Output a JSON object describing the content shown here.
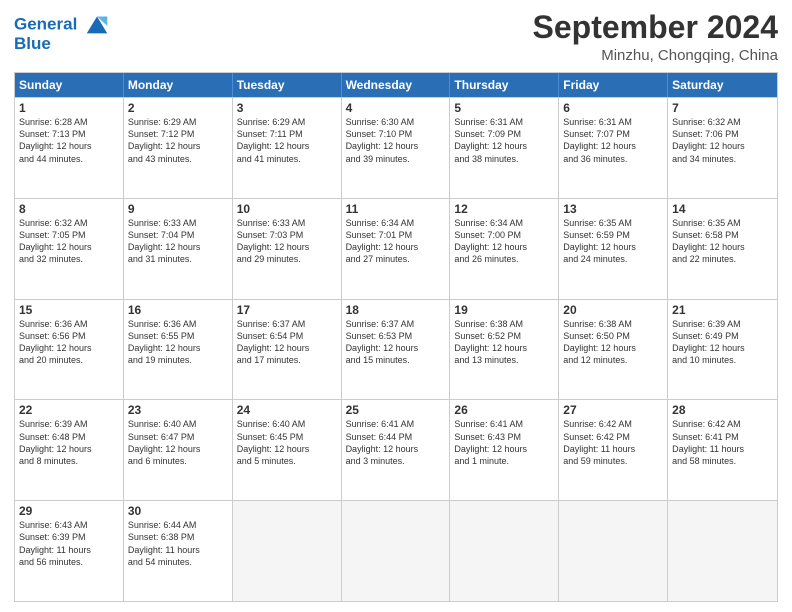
{
  "header": {
    "logo_line1": "General",
    "logo_line2": "Blue",
    "month": "September 2024",
    "location": "Minzhu, Chongqing, China"
  },
  "weekdays": [
    "Sunday",
    "Monday",
    "Tuesday",
    "Wednesday",
    "Thursday",
    "Friday",
    "Saturday"
  ],
  "rows": [
    [
      {
        "day": "1",
        "lines": [
          "Sunrise: 6:28 AM",
          "Sunset: 7:13 PM",
          "Daylight: 12 hours",
          "and 44 minutes."
        ]
      },
      {
        "day": "2",
        "lines": [
          "Sunrise: 6:29 AM",
          "Sunset: 7:12 PM",
          "Daylight: 12 hours",
          "and 43 minutes."
        ]
      },
      {
        "day": "3",
        "lines": [
          "Sunrise: 6:29 AM",
          "Sunset: 7:11 PM",
          "Daylight: 12 hours",
          "and 41 minutes."
        ]
      },
      {
        "day": "4",
        "lines": [
          "Sunrise: 6:30 AM",
          "Sunset: 7:10 PM",
          "Daylight: 12 hours",
          "and 39 minutes."
        ]
      },
      {
        "day": "5",
        "lines": [
          "Sunrise: 6:31 AM",
          "Sunset: 7:09 PM",
          "Daylight: 12 hours",
          "and 38 minutes."
        ]
      },
      {
        "day": "6",
        "lines": [
          "Sunrise: 6:31 AM",
          "Sunset: 7:07 PM",
          "Daylight: 12 hours",
          "and 36 minutes."
        ]
      },
      {
        "day": "7",
        "lines": [
          "Sunrise: 6:32 AM",
          "Sunset: 7:06 PM",
          "Daylight: 12 hours",
          "and 34 minutes."
        ]
      }
    ],
    [
      {
        "day": "8",
        "lines": [
          "Sunrise: 6:32 AM",
          "Sunset: 7:05 PM",
          "Daylight: 12 hours",
          "and 32 minutes."
        ]
      },
      {
        "day": "9",
        "lines": [
          "Sunrise: 6:33 AM",
          "Sunset: 7:04 PM",
          "Daylight: 12 hours",
          "and 31 minutes."
        ]
      },
      {
        "day": "10",
        "lines": [
          "Sunrise: 6:33 AM",
          "Sunset: 7:03 PM",
          "Daylight: 12 hours",
          "and 29 minutes."
        ]
      },
      {
        "day": "11",
        "lines": [
          "Sunrise: 6:34 AM",
          "Sunset: 7:01 PM",
          "Daylight: 12 hours",
          "and 27 minutes."
        ]
      },
      {
        "day": "12",
        "lines": [
          "Sunrise: 6:34 AM",
          "Sunset: 7:00 PM",
          "Daylight: 12 hours",
          "and 26 minutes."
        ]
      },
      {
        "day": "13",
        "lines": [
          "Sunrise: 6:35 AM",
          "Sunset: 6:59 PM",
          "Daylight: 12 hours",
          "and 24 minutes."
        ]
      },
      {
        "day": "14",
        "lines": [
          "Sunrise: 6:35 AM",
          "Sunset: 6:58 PM",
          "Daylight: 12 hours",
          "and 22 minutes."
        ]
      }
    ],
    [
      {
        "day": "15",
        "lines": [
          "Sunrise: 6:36 AM",
          "Sunset: 6:56 PM",
          "Daylight: 12 hours",
          "and 20 minutes."
        ]
      },
      {
        "day": "16",
        "lines": [
          "Sunrise: 6:36 AM",
          "Sunset: 6:55 PM",
          "Daylight: 12 hours",
          "and 19 minutes."
        ]
      },
      {
        "day": "17",
        "lines": [
          "Sunrise: 6:37 AM",
          "Sunset: 6:54 PM",
          "Daylight: 12 hours",
          "and 17 minutes."
        ]
      },
      {
        "day": "18",
        "lines": [
          "Sunrise: 6:37 AM",
          "Sunset: 6:53 PM",
          "Daylight: 12 hours",
          "and 15 minutes."
        ]
      },
      {
        "day": "19",
        "lines": [
          "Sunrise: 6:38 AM",
          "Sunset: 6:52 PM",
          "Daylight: 12 hours",
          "and 13 minutes."
        ]
      },
      {
        "day": "20",
        "lines": [
          "Sunrise: 6:38 AM",
          "Sunset: 6:50 PM",
          "Daylight: 12 hours",
          "and 12 minutes."
        ]
      },
      {
        "day": "21",
        "lines": [
          "Sunrise: 6:39 AM",
          "Sunset: 6:49 PM",
          "Daylight: 12 hours",
          "and 10 minutes."
        ]
      }
    ],
    [
      {
        "day": "22",
        "lines": [
          "Sunrise: 6:39 AM",
          "Sunset: 6:48 PM",
          "Daylight: 12 hours",
          "and 8 minutes."
        ]
      },
      {
        "day": "23",
        "lines": [
          "Sunrise: 6:40 AM",
          "Sunset: 6:47 PM",
          "Daylight: 12 hours",
          "and 6 minutes."
        ]
      },
      {
        "day": "24",
        "lines": [
          "Sunrise: 6:40 AM",
          "Sunset: 6:45 PM",
          "Daylight: 12 hours",
          "and 5 minutes."
        ]
      },
      {
        "day": "25",
        "lines": [
          "Sunrise: 6:41 AM",
          "Sunset: 6:44 PM",
          "Daylight: 12 hours",
          "and 3 minutes."
        ]
      },
      {
        "day": "26",
        "lines": [
          "Sunrise: 6:41 AM",
          "Sunset: 6:43 PM",
          "Daylight: 12 hours",
          "and 1 minute."
        ]
      },
      {
        "day": "27",
        "lines": [
          "Sunrise: 6:42 AM",
          "Sunset: 6:42 PM",
          "Daylight: 11 hours",
          "and 59 minutes."
        ]
      },
      {
        "day": "28",
        "lines": [
          "Sunrise: 6:42 AM",
          "Sunset: 6:41 PM",
          "Daylight: 11 hours",
          "and 58 minutes."
        ]
      }
    ],
    [
      {
        "day": "29",
        "lines": [
          "Sunrise: 6:43 AM",
          "Sunset: 6:39 PM",
          "Daylight: 11 hours",
          "and 56 minutes."
        ]
      },
      {
        "day": "30",
        "lines": [
          "Sunrise: 6:44 AM",
          "Sunset: 6:38 PM",
          "Daylight: 11 hours",
          "and 54 minutes."
        ]
      },
      {
        "day": "",
        "lines": []
      },
      {
        "day": "",
        "lines": []
      },
      {
        "day": "",
        "lines": []
      },
      {
        "day": "",
        "lines": []
      },
      {
        "day": "",
        "lines": []
      }
    ]
  ]
}
